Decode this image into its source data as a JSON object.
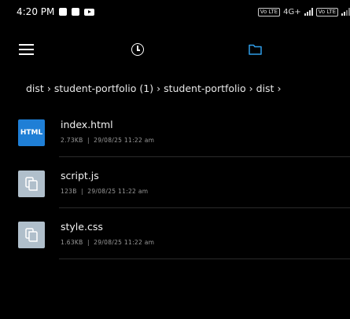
{
  "status_bar": {
    "time": "4:20 PM",
    "network_label": "4G+",
    "volte_1": "Vo LTE",
    "volte_2": "Vo LTE"
  },
  "toolbar": {
    "menu_icon": "menu-icon",
    "recent_icon": "clock-icon",
    "folder_icon": "folder-icon",
    "accent": "#2f9de8"
  },
  "breadcrumb": [
    {
      "label": "dist"
    },
    {
      "label": "student-portfolio (1)"
    },
    {
      "label": "student-portfolio"
    },
    {
      "label": "dist"
    }
  ],
  "files": [
    {
      "name": "index.html",
      "size": "2.73KB",
      "date": "29/08/25 11:22 am",
      "type_label": "HTML"
    },
    {
      "name": "script.js",
      "size": "123B",
      "date": "29/08/25 11:22 am"
    },
    {
      "name": "style.css",
      "size": "1.63KB",
      "date": "29/08/25 11:22 am"
    }
  ]
}
